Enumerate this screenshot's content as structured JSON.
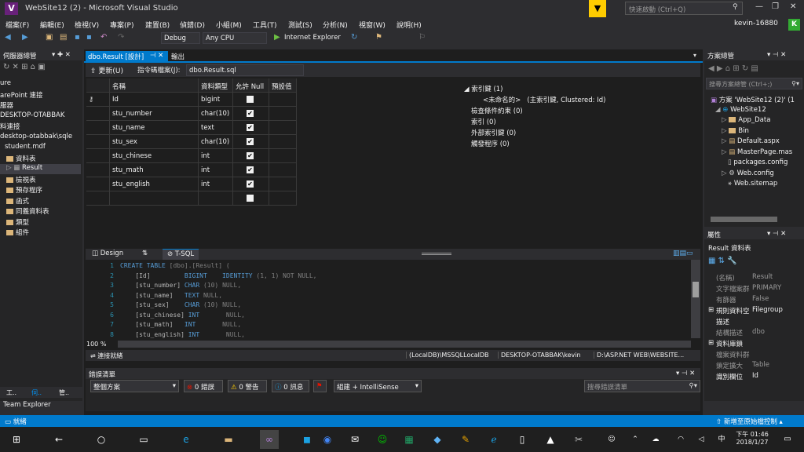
{
  "window": {
    "title": "WebSite12 (2) - Microsoft Visual Studio",
    "quick_launch": "快速啟動 (Ctrl+Q)",
    "user": "kevin-16880",
    "avatar_letter": "K"
  },
  "menu": [
    "檔案(F)",
    "編輯(E)",
    "檢視(V)",
    "專案(P)",
    "建置(B)",
    "偵錯(D)",
    "小組(M)",
    "工具(T)",
    "測試(S)",
    "分析(N)",
    "視窗(W)",
    "說明(H)"
  ],
  "toolbar": {
    "config": "Debug",
    "platform": "Any CPU",
    "browser": "Internet Explorer"
  },
  "server_explorer": {
    "title": "伺服器總管",
    "items": [
      "ure",
      "arePoint 連接",
      "服器",
      "DESKTOP-OTABBAK",
      "料連接",
      "desktop-otabbak\\sqle",
      "student.mdf",
      "資料表",
      "Result",
      "檢視表",
      "預存程序",
      "函式",
      "同義資料表",
      "類型",
      "組件"
    ],
    "bottom_tabs": [
      "工..",
      "伺..",
      "管.."
    ],
    "team_explorer": "Team Explorer"
  },
  "doc_tabs": {
    "active": "dbo.Result [設計]",
    "second": "輸出"
  },
  "designer": {
    "update": "更新(U)",
    "script_file_label": "指令碼檔案(J):",
    "script_file": "dbo.Result.sql"
  },
  "columns_header": {
    "name": "名稱",
    "type": "資料類型",
    "nulls": "允許 Null",
    "default": "預設值"
  },
  "columns": [
    {
      "name": "Id",
      "type": "bigint",
      "nullable": false,
      "key": true
    },
    {
      "name": "stu_number",
      "type": "char(10)",
      "nullable": true
    },
    {
      "name": "stu_name",
      "type": "text",
      "nullable": true
    },
    {
      "name": "stu_sex",
      "type": "char(10)",
      "nullable": true
    },
    {
      "name": "stu_chinese",
      "type": "int",
      "nullable": true
    },
    {
      "name": "stu_math",
      "type": "int",
      "nullable": true
    },
    {
      "name": "stu_english",
      "type": "int",
      "nullable": true
    },
    {
      "name": "",
      "type": "",
      "nullable": false
    }
  ],
  "keys": {
    "index_keys": "索引鍵 (1)",
    "unnamed": "<未命名的>",
    "unnamed_desc": "(主索引鍵, Clustered: Id)",
    "check": "檢查條件約束 (0)",
    "index": "索引 (0)",
    "fk": "外部索引鍵 (0)",
    "trigger": "觸發程序 (0)"
  },
  "split": {
    "design": "Design",
    "tsql": "T-SQL"
  },
  "code": [
    {
      "n": "1",
      "t": "CREATE TABLE [dbo].[Result] ("
    },
    {
      "n": "2",
      "t": "    [Id]          BIGINT    IDENTITY (1, 1) NOT NULL,"
    },
    {
      "n": "3",
      "t": "    [stu_number]  CHAR (10) NULL,"
    },
    {
      "n": "4",
      "t": "    [stu_name]    TEXT NULL,"
    },
    {
      "n": "5",
      "t": "    [stu_sex]     CHAR (10) NULL,"
    },
    {
      "n": "6",
      "t": "    [stu_chinese] INT       NULL,"
    },
    {
      "n": "7",
      "t": "    [stu_math]    INT       NULL,"
    },
    {
      "n": "8",
      "t": "    [stu_english] INT       NULL,"
    }
  ],
  "zoom": "100 %",
  "status": {
    "connected": "連接就緒",
    "db": "(LocalDB)\\MSSQLLocalDB",
    "user": "DESKTOP-OTABBAK\\kevin",
    "path": "D:\\ASP.NET WEB\\WEBSITE..."
  },
  "error_list": {
    "title": "錯誤清單",
    "scope": "整個方案",
    "errors": "0 錯誤",
    "warnings": "0 警告",
    "messages": "0 訊息",
    "build": "組建 + IntelliSense",
    "search": "搜尋錯誤清單"
  },
  "solution_explorer": {
    "title": "方案總管",
    "search": "搜尋方案總管 (Ctrl+;)",
    "items": [
      "方案 'WebSite12 (2)' (1",
      "WebSite12",
      "App_Data",
      "Bin",
      "Default.aspx",
      "MasterPage.mas",
      "packages.config",
      "Web.config",
      "Web.sitemap"
    ]
  },
  "properties": {
    "title": "屬性",
    "object": "Result  資料表",
    "rows": [
      {
        "k": "(名稱)",
        "v": "Result"
      },
      {
        "k": "文字檔案群",
        "v": "PRIMARY"
      },
      {
        "k": "有篩器",
        "v": "False"
      },
      {
        "k": "規則資料空",
        "v": "Filegroup"
      },
      {
        "k": "描述",
        "v": ""
      },
      {
        "k": "結構描述",
        "v": "dbo"
      },
      {
        "k": "資料庫鎖",
        "v": ""
      },
      {
        "k": "檔案資料群",
        "v": ""
      },
      {
        "k": "鎖定擴大",
        "v": "Table"
      },
      {
        "k": "識別欄位",
        "v": "Id"
      }
    ]
  },
  "statusbar": {
    "ready": "就緒",
    "source_control": "新增至原始檔控制"
  },
  "taskbar": {
    "time": "下午 01:46",
    "date": "2018/1/27",
    "ime": "中"
  }
}
